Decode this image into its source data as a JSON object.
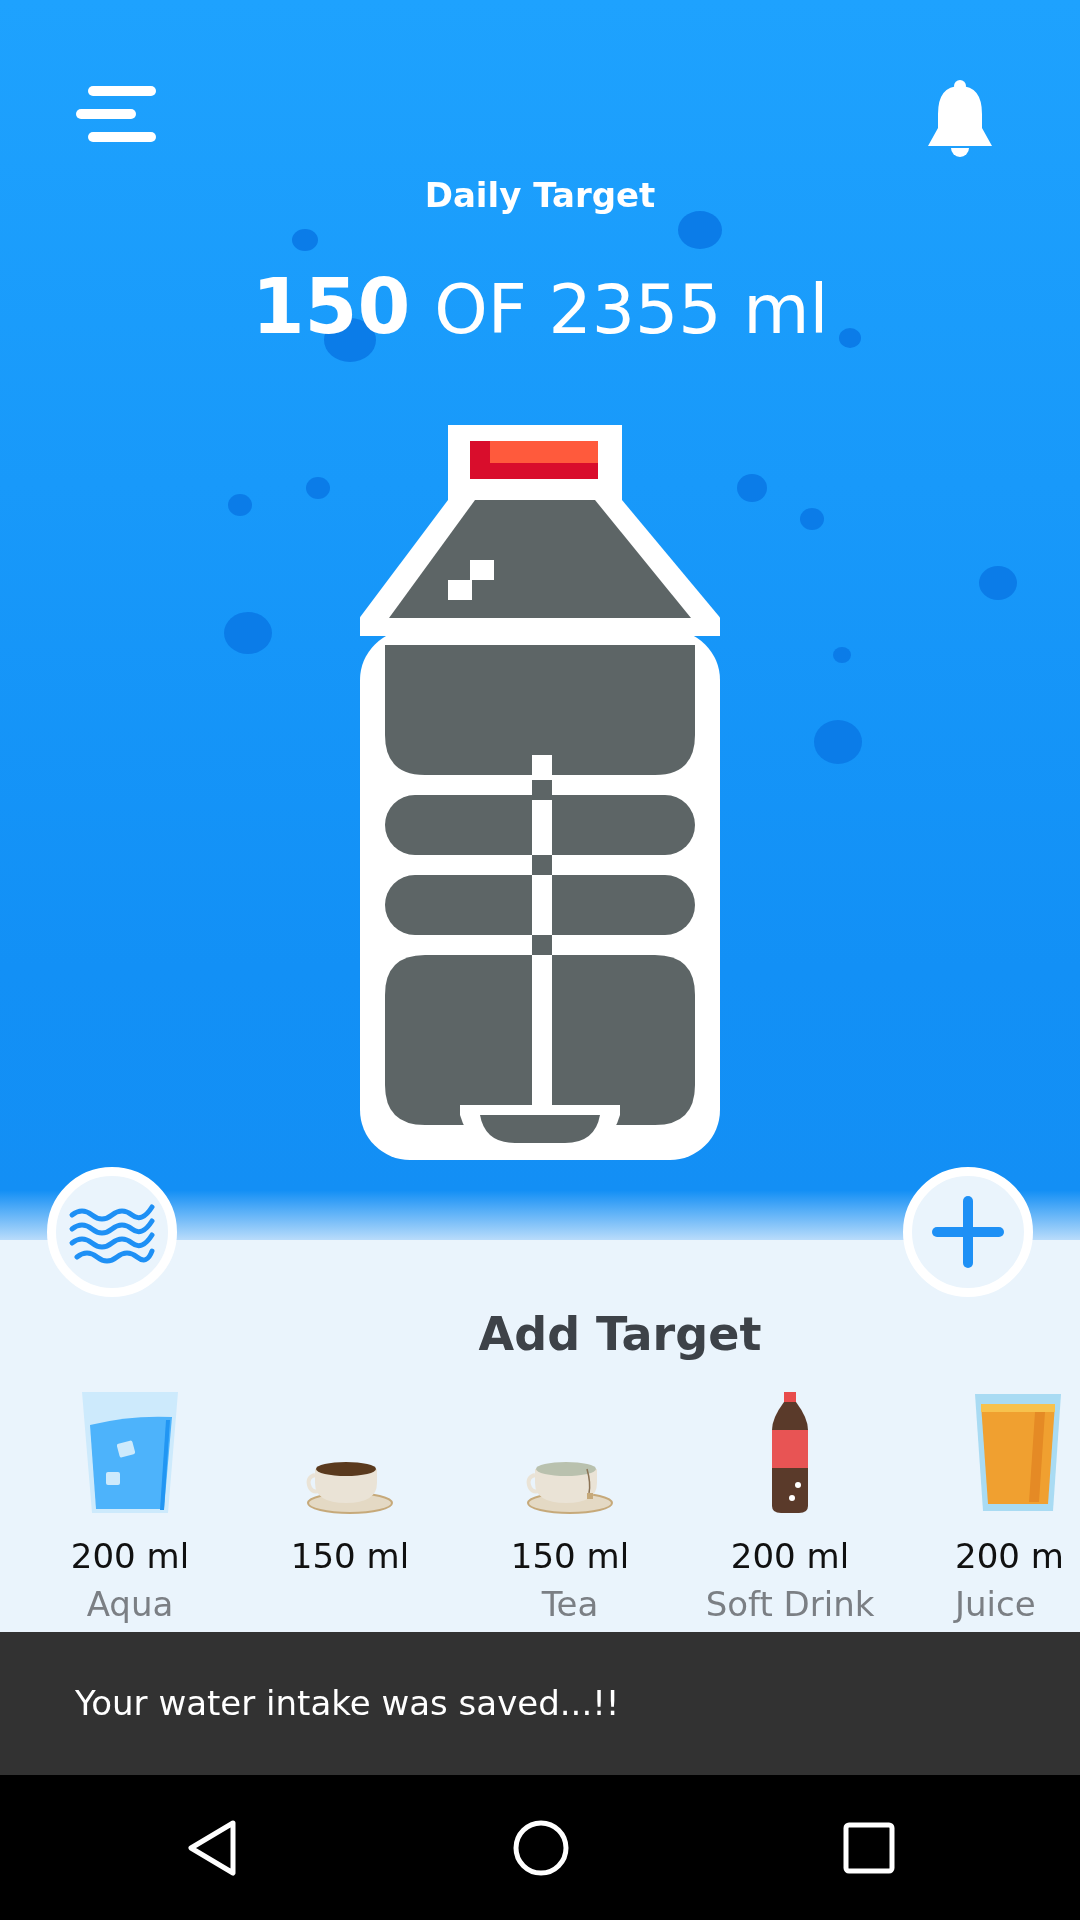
{
  "header": {
    "title": "Daily Target",
    "current": "150",
    "total": "OF 2355 ml"
  },
  "section_title": "Add Target",
  "drinks": [
    {
      "kind": "water",
      "amount": "200 ml",
      "name": "Aqua"
    },
    {
      "kind": "coffee",
      "amount": "150 ml"
    },
    {
      "kind": "tea",
      "amount": "150 ml",
      "name": "Tea"
    },
    {
      "kind": "soda",
      "amount": "200 ml",
      "name": "Soft Drink"
    },
    {
      "kind": "juice",
      "amount": "200 m",
      "name": "Juice"
    }
  ],
  "snackbar": {
    "message": "Your water intake was saved...!!"
  }
}
